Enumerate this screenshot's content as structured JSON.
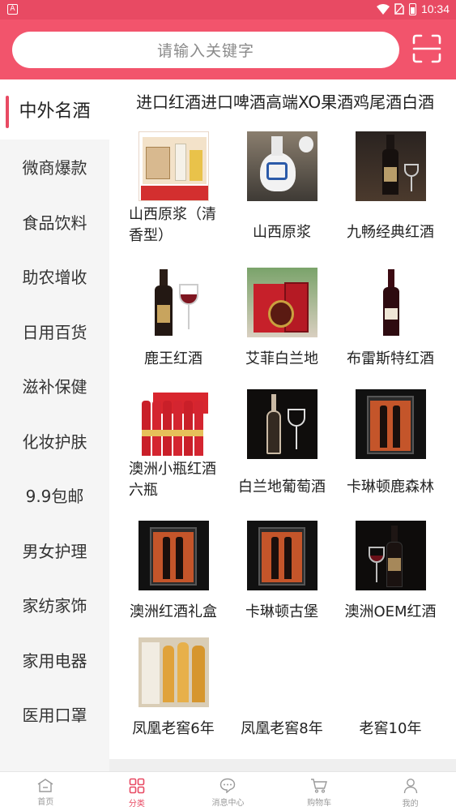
{
  "statusbar": {
    "time": "10:34",
    "app_badge": "A"
  },
  "search": {
    "placeholder": "请输入关键字"
  },
  "sidebar": {
    "items": [
      {
        "label": "中外名酒",
        "active": true
      },
      {
        "label": "微商爆款"
      },
      {
        "label": "食品饮料"
      },
      {
        "label": "助农增收"
      },
      {
        "label": "日用百货"
      },
      {
        "label": "滋补保健"
      },
      {
        "label": "化妆护肤"
      },
      {
        "label": "9.9包邮"
      },
      {
        "label": "男女护理"
      },
      {
        "label": "家纺家饰"
      },
      {
        "label": "家用电器"
      },
      {
        "label": "医用口罩"
      }
    ]
  },
  "subcategories": [
    "进口红酒",
    "进口啤酒",
    "高端XO",
    "果酒",
    "鸡尾酒",
    "白酒"
  ],
  "products": [
    {
      "name": "山西原浆（清香型）",
      "image": "baijiu-box"
    },
    {
      "name": "山西原浆",
      "image": "blue-white-bottle"
    },
    {
      "name": "九畅经典红酒",
      "image": "red-wine-glasses"
    },
    {
      "name": "鹿王红酒",
      "image": "red-wine-glass"
    },
    {
      "name": "艾菲白兰地",
      "image": "brandy-gift"
    },
    {
      "name": "布雷斯特红酒",
      "image": "red-wine-bottle"
    },
    {
      "name": "澳洲小瓶红酒六瓶",
      "image": "six-bottles"
    },
    {
      "name": "白兰地葡萄酒",
      "image": "brandy-glass"
    },
    {
      "name": "卡琳顿鹿森林",
      "image": "wine-case"
    },
    {
      "name": "澳洲红酒礼盒",
      "image": "wine-case"
    },
    {
      "name": "卡琳顿古堡",
      "image": "wine-case"
    },
    {
      "name": "澳洲OEM红酒",
      "image": "red-wine-glasses-dark"
    },
    {
      "name": "凤凰老窖6年",
      "image": "gold-bottles"
    },
    {
      "name": "凤凰老窖8年",
      "image": "none"
    },
    {
      "name": "老窖10年",
      "image": "none"
    }
  ],
  "tabbar": [
    {
      "label": "首页",
      "icon": "home-icon"
    },
    {
      "label": "分类",
      "icon": "category-icon",
      "active": true
    },
    {
      "label": "消息中心",
      "icon": "message-icon"
    },
    {
      "label": "购物车",
      "icon": "cart-icon"
    },
    {
      "label": "我的",
      "icon": "profile-icon"
    }
  ],
  "colors": {
    "accent": "#e84a63",
    "header": "#f2546c"
  }
}
